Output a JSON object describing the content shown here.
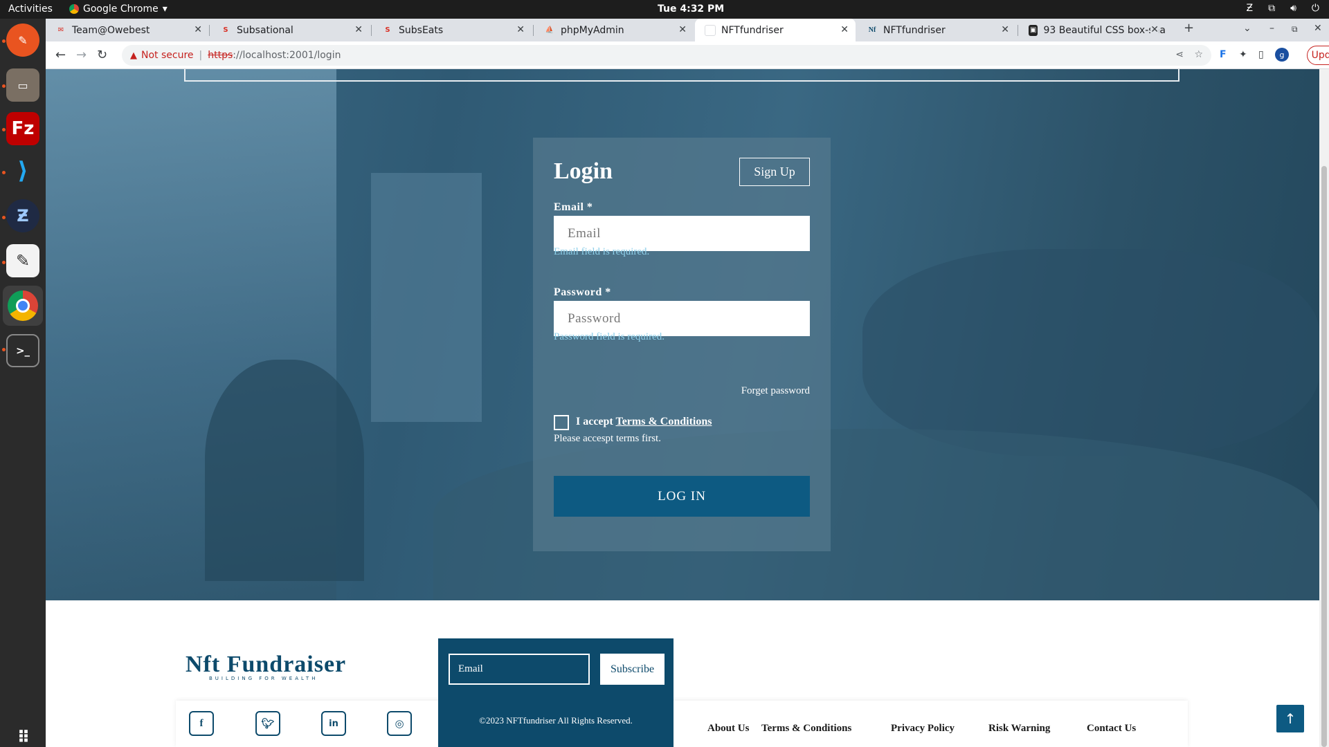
{
  "system": {
    "activities": "Activities",
    "app_name": "Google Chrome",
    "clock": "Tue  4:32 PM"
  },
  "dock": {
    "apps": [
      "Inkscape",
      "Files",
      "FileZilla",
      "Visual Studio Code",
      "Zoom",
      "Text Editor",
      "Google Chrome",
      "Terminal",
      "Show Applications"
    ]
  },
  "browser": {
    "tabs": [
      {
        "title": "Team@Owebest",
        "icon": "mail-icon"
      },
      {
        "title": "Subsational",
        "icon": "subsational-icon"
      },
      {
        "title": "SubsEats",
        "icon": "subseats-icon"
      },
      {
        "title": "phpMyAdmin",
        "icon": "phpmyadmin-icon"
      },
      {
        "title": "NFTfundriser",
        "icon": "blank-page-icon",
        "active": true
      },
      {
        "title": "NFTfundriser",
        "icon": "nf-icon"
      },
      {
        "title": "93 Beautiful CSS box-sha",
        "icon": "codepen-icon"
      }
    ],
    "not_secure": "Not secure",
    "url_scheme": "https",
    "url_rest": "://localhost:2001/login",
    "update_label": "Update",
    "profile_initial": "g"
  },
  "login": {
    "title": "Login",
    "signup_label": "Sign Up",
    "email_label": "Email *",
    "email_placeholder": "Email",
    "email_error": "Email field is required.",
    "password_label": "Password *",
    "password_placeholder": "Password",
    "password_error": "Password field is required.",
    "forget_label": "Forget password",
    "accept_prefix": "I accept",
    "terms_link": "Terms & Conditions",
    "terms_error": "Please accespt terms first.",
    "login_button": "LOG IN"
  },
  "footer": {
    "brand": "Nft Fundraiser",
    "tagline": "BUILDING FOR WEALTH",
    "newsletter_placeholder": "Email",
    "subscribe_label": "Subscribe",
    "copyright": "©2023 NFTfundriser All Rights Reserved.",
    "social": [
      "f",
      "t",
      "in",
      "ig"
    ],
    "links": [
      "About Us",
      "Terms & Conditions",
      "Privacy Policy",
      "Risk Warning",
      "Contact Us"
    ]
  },
  "colors": {
    "brand": "#0d4a6b",
    "button": "#0d5a82",
    "error": "#8fd0ea",
    "card_overlay": "#54788e"
  }
}
